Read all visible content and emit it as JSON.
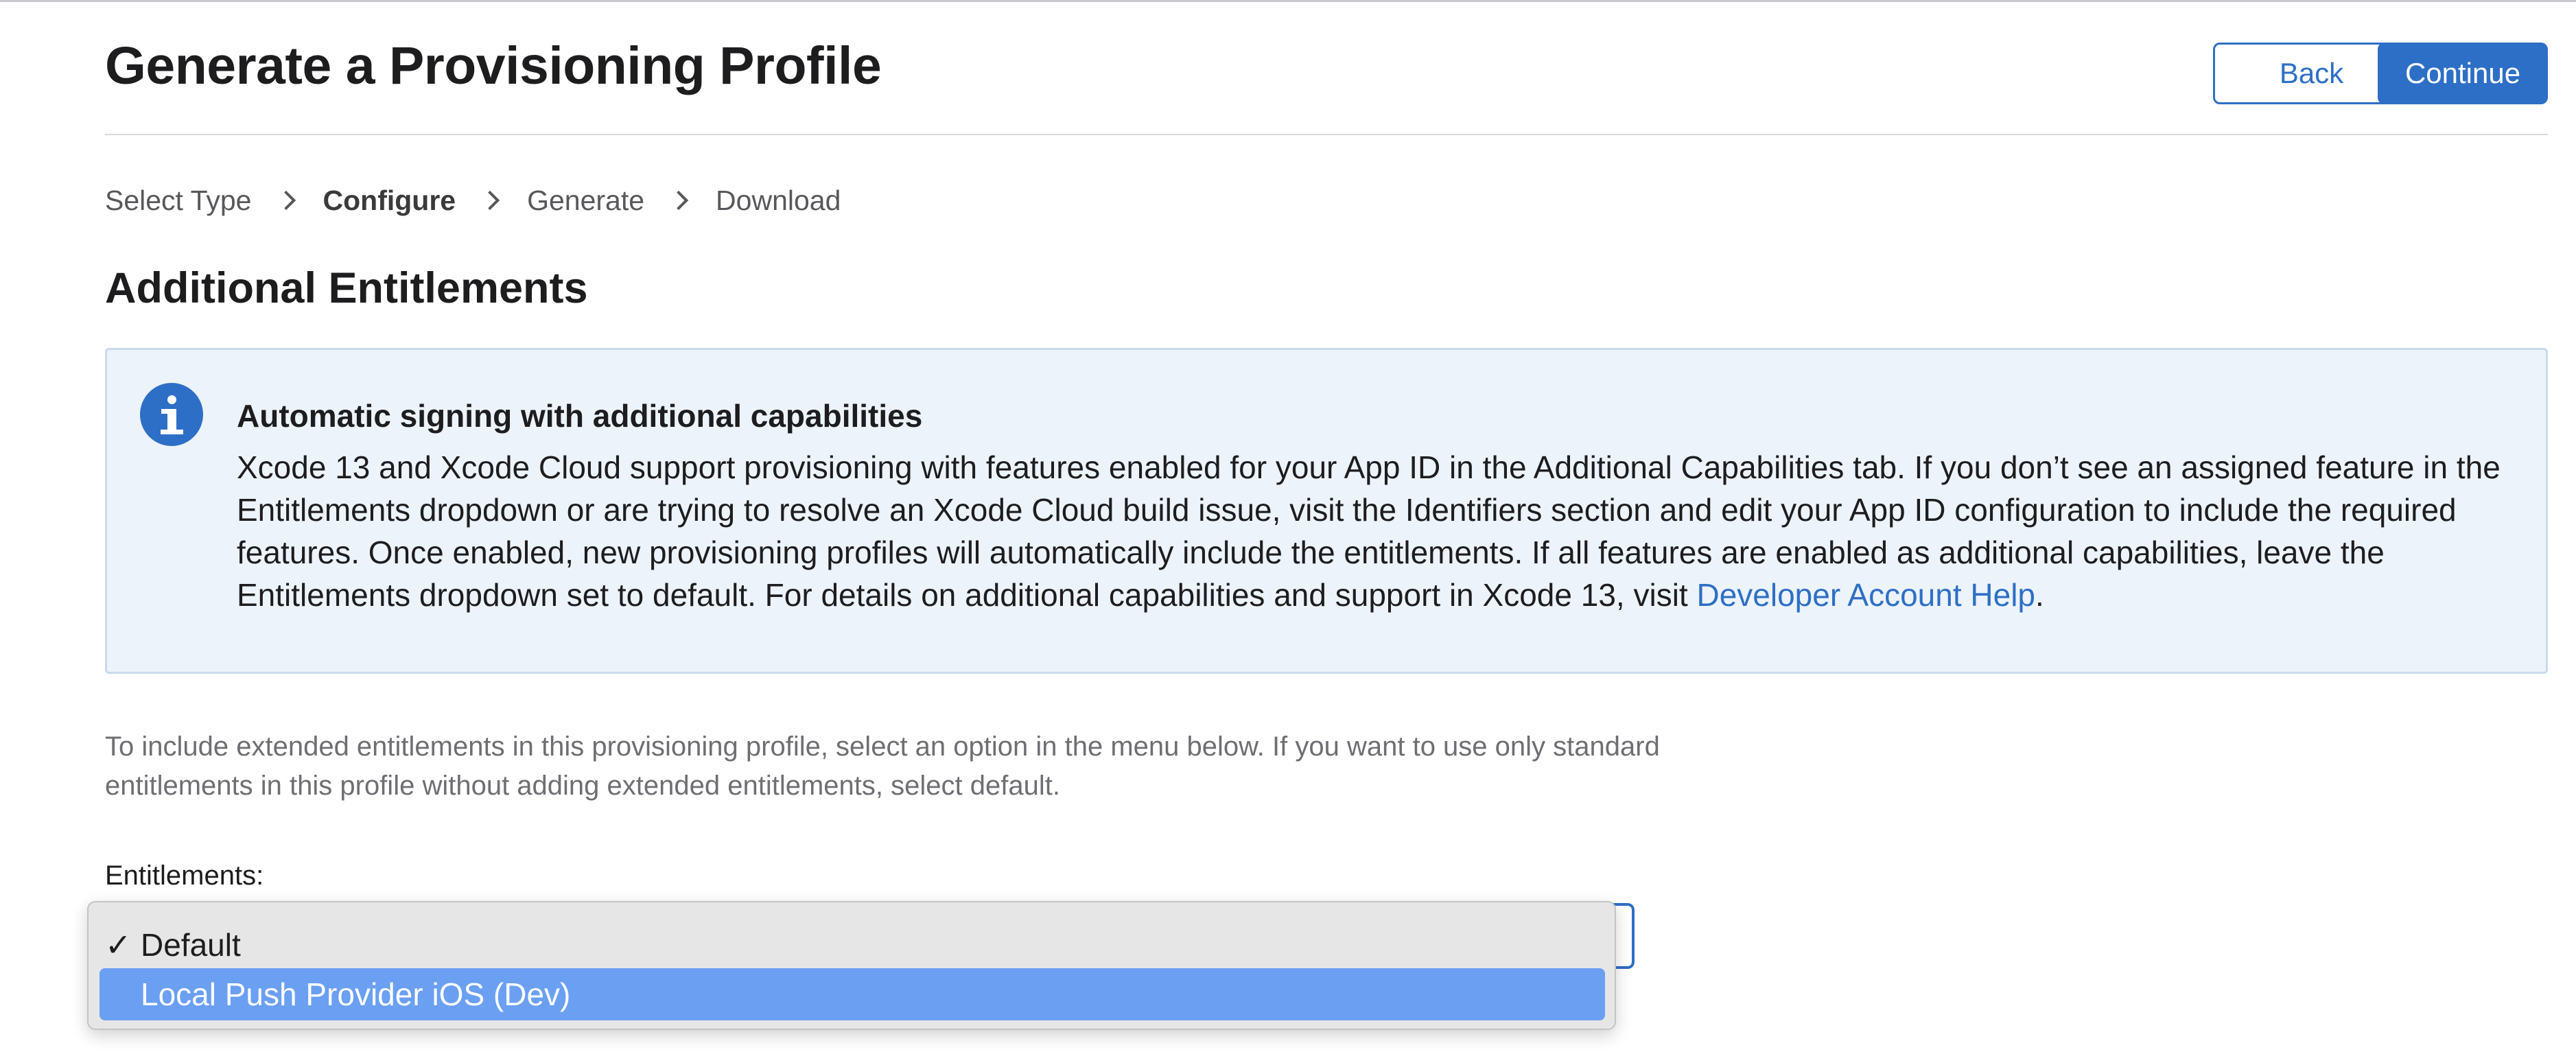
{
  "header": {
    "title": "Generate a Provisioning Profile",
    "back_label": "Back",
    "continue_label": "Continue"
  },
  "steps": [
    {
      "label": "Select Type",
      "active": false
    },
    {
      "label": "Configure",
      "active": true
    },
    {
      "label": "Generate",
      "active": false
    },
    {
      "label": "Download",
      "active": false
    }
  ],
  "section": {
    "title": "Additional Entitlements"
  },
  "info": {
    "icon": "info-icon",
    "heading": "Automatic signing with additional capabilities",
    "body_before_link": "Xcode 13 and Xcode Cloud support provisioning with features enabled for your App ID in the Additional Capabilities tab. If you don’t see an assigned feature in the Entitlements dropdown or are trying to resolve an Xcode Cloud build issue, visit the Identifiers section and edit your App ID configuration to include the required features. Once enabled, new provisioning profiles will automatically include the entitlements. If all features are enabled as additional capabilities, leave the Entitlements dropdown set to default. For details on additional capabilities and support in Xcode 13, visit ",
    "link_text": "Developer Account Help",
    "body_after_link": "."
  },
  "description": "To include extended entitlements in this provisioning profile, select an option in the menu below. If you want to use only standard entitlements in this profile without adding extended entitlements, select default.",
  "entitlements": {
    "label": "Entitlements:",
    "options": [
      {
        "label": "Default",
        "checked": true,
        "highlighted": false
      },
      {
        "label": "Local Push Provider iOS (Dev)",
        "checked": false,
        "highlighted": true
      }
    ],
    "check_mark": "✓"
  },
  "colors": {
    "accent": "#2d6fc6",
    "info_bg": "#edf3fa",
    "highlight": "#6a9ff2"
  }
}
